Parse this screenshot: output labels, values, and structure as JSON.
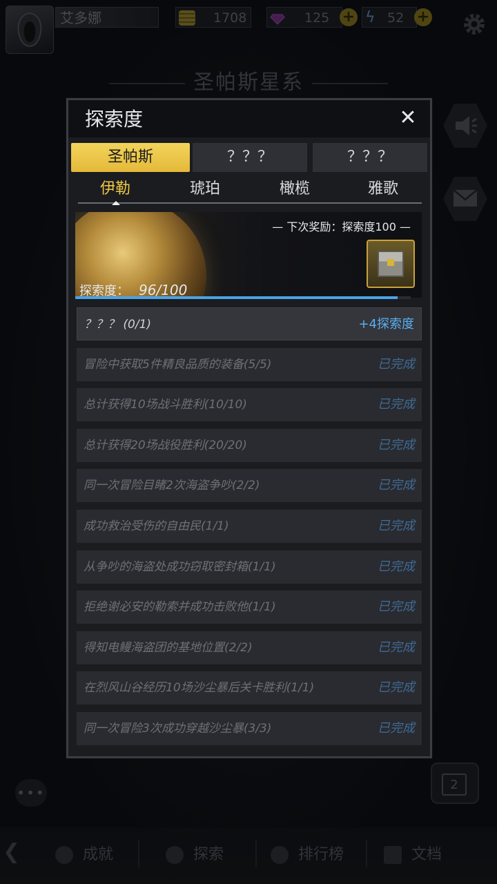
{
  "topbar": {
    "player_name": "艾多娜",
    "coins": "1708",
    "gems": "125",
    "energy": "52"
  },
  "system_title": "圣帕斯星系",
  "bottom_nav": {
    "items": [
      {
        "label": "成就"
      },
      {
        "label": "探索"
      },
      {
        "label": "排行榜"
      },
      {
        "label": "文档"
      }
    ]
  },
  "calendar_badge": "2",
  "modal": {
    "title": "探索度",
    "close": "✕",
    "tabs": [
      {
        "label": "圣帕斯",
        "active": true
      },
      {
        "label": "？？？",
        "active": false
      },
      {
        "label": "？？？",
        "active": false
      }
    ],
    "subtabs": [
      {
        "label": "伊勒",
        "active": true
      },
      {
        "label": "琥珀",
        "active": false
      },
      {
        "label": "橄榄",
        "active": false
      },
      {
        "label": "雅歌",
        "active": false
      }
    ],
    "next_reward": "— 下次奖励：探索度100 —",
    "progress_label": "探索度：",
    "progress_value": "96/100",
    "progress_fraction": 0.96,
    "tasks": [
      {
        "text": "？？？ (0/1)",
        "status": "+4探索度"
      },
      {
        "text": "冒险中获取5件精良品质的装备(5/5)",
        "status": "已完成"
      },
      {
        "text": "总计获得10场战斗胜利(10/10)",
        "status": "已完成"
      },
      {
        "text": "总计获得20场战役胜利(20/20)",
        "status": "已完成"
      },
      {
        "text": "同一次冒险目睹2次海盗争吵(2/2)",
        "status": "已完成"
      },
      {
        "text": "成功救治受伤的自由民(1/1)",
        "status": "已完成"
      },
      {
        "text": "从争吵的海盗处成功窃取密封箱(1/1)",
        "status": "已完成"
      },
      {
        "text": "拒绝谢必安的勒索并成功击败他(1/1)",
        "status": "已完成"
      },
      {
        "text": "得知电鳗海盗团的基地位置(2/2)",
        "status": "已完成"
      },
      {
        "text": "在烈风山谷经历10场沙尘暴后关卡胜利(1/1)",
        "status": "已完成"
      },
      {
        "text": "同一次冒险3次成功穿越沙尘暴(3/3)",
        "status": "已完成"
      }
    ]
  },
  "colors": {
    "accent_gold": "#f0c744",
    "progress_blue": "#4aa3e6",
    "done_blue": "#3f6a94"
  }
}
